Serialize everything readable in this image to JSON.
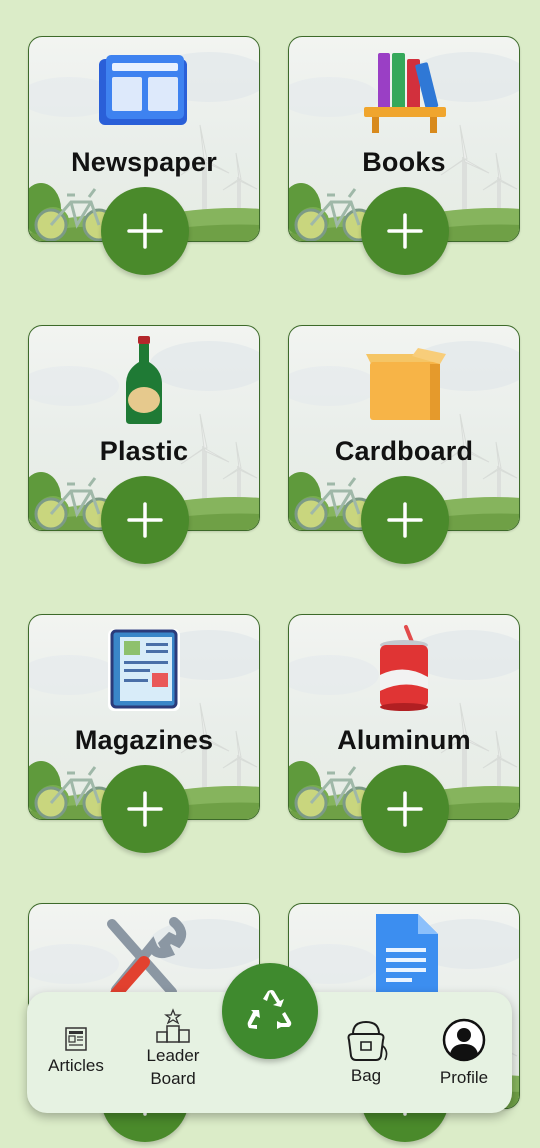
{
  "colors": {
    "background": "#dbecc8",
    "accent": "#4a8a2b",
    "nav_bg": "#e6f2e2",
    "card_border": "#3d6a2a"
  },
  "categories": [
    {
      "label": "Newspaper",
      "icon": "newspaper-icon"
    },
    {
      "label": "Books",
      "icon": "books-icon"
    },
    {
      "label": "Plastic",
      "icon": "bottle-icon"
    },
    {
      "label": "Cardboard",
      "icon": "box-icon"
    },
    {
      "label": "Magazines",
      "icon": "magazine-icon"
    },
    {
      "label": "Aluminum",
      "icon": "can-icon"
    },
    {
      "label": "",
      "icon": "tools-icon"
    },
    {
      "label": "",
      "icon": "document-icon"
    }
  ],
  "nav": {
    "articles": "Articles",
    "leaderboard_line1": "Leader",
    "leaderboard_line2": "Board",
    "bag": "Bag",
    "profile": "Profile",
    "center_icon": "recycle-icon"
  }
}
